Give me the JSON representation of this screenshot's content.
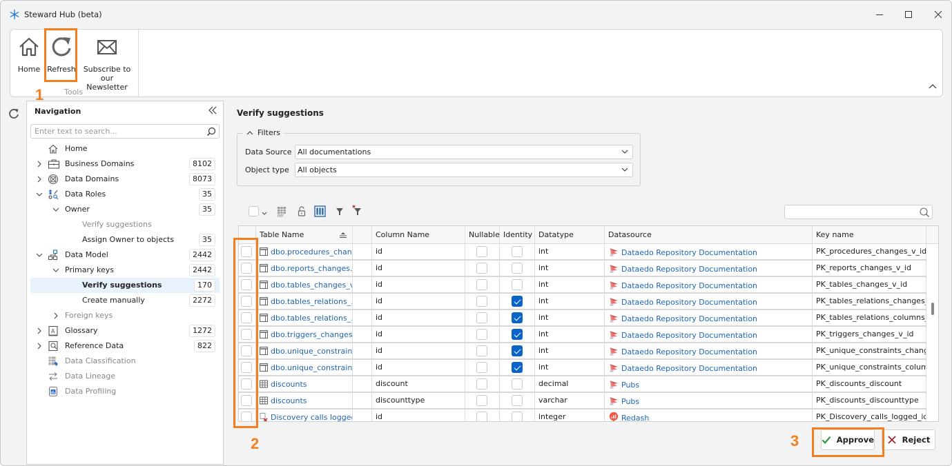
{
  "window": {
    "title": "Steward Hub (beta)",
    "controls": [
      "minimize",
      "maximize",
      "close"
    ]
  },
  "ribbon": {
    "buttons": [
      {
        "label": "Home",
        "icon": "home-icon"
      },
      {
        "label": "Refresh",
        "icon": "refresh-icon"
      },
      {
        "label": "Subscribe to our Newsletter",
        "line1": "Subscribe to",
        "line2": "our Newsletter",
        "icon": "envelope-icon"
      }
    ],
    "group_label": "Tools"
  },
  "annotations": {
    "step1": "1",
    "step2": "2",
    "step3": "3",
    "highlight_color": "#f47d20"
  },
  "navigation": {
    "title": "Navigation",
    "search_placeholder": "Enter text to search...",
    "items": [
      {
        "label": "Home",
        "count": null,
        "expander": "none",
        "icon": "home-icon"
      },
      {
        "label": "Business Domains",
        "count": "8102",
        "expander": "collapsed",
        "icon": "briefcase-icon"
      },
      {
        "label": "Data Domains",
        "count": "8073",
        "expander": "collapsed",
        "icon": "globe-icon"
      },
      {
        "label": "Data Roles",
        "count": "35",
        "expander": "expanded",
        "icon": "data-roles-icon"
      },
      {
        "label": "Owner",
        "count": "35",
        "expander": "expanded"
      },
      {
        "label": "Verify suggestions",
        "count": null,
        "dim": true
      },
      {
        "label": "Assign Owner to objects",
        "count": "35"
      },
      {
        "label": "Data Model",
        "count": "2442",
        "expander": "expanded",
        "icon": "data-model-icon"
      },
      {
        "label": "Primary keys",
        "count": "2442",
        "expander": "expanded"
      },
      {
        "label": "Verify suggestions",
        "count": "170",
        "selected": true
      },
      {
        "label": "Create manually",
        "count": "2272"
      },
      {
        "label": "Foreign keys",
        "count": null,
        "expander": "collapsed",
        "dim": true
      },
      {
        "label": "Glossary",
        "count": "1272",
        "expander": "collapsed",
        "icon": "glossary-icon"
      },
      {
        "label": "Reference Data",
        "count": "822",
        "expander": "collapsed",
        "icon": "reference-data-icon"
      },
      {
        "label": "Data Classification",
        "count": null,
        "dim": true,
        "icon": "classification-icon"
      },
      {
        "label": "Data Lineage",
        "count": null,
        "dim": true,
        "icon": "lineage-icon"
      },
      {
        "label": "Data Profiling",
        "count": null,
        "dim": true,
        "icon": "profiling-icon"
      }
    ]
  },
  "main": {
    "title": "Verify suggestions",
    "filters": {
      "legend": "Filters",
      "data_source_label": "Data Source",
      "data_source_value": "All documentations",
      "object_type_label": "Object type",
      "object_type_value": "All objects"
    },
    "grid": {
      "search_value": "",
      "columns": [
        "Table Name",
        "Column Name",
        "Nullable",
        "Identity",
        "Datatype",
        "Datasource",
        "Key name"
      ],
      "rows": [
        {
          "selected": false,
          "table": "dbo.procedures_chan...",
          "table_icon": "view-icon",
          "column": "id",
          "nullable": false,
          "identity": false,
          "datatype": "int",
          "datasource": "Dataedo Repository Documentation",
          "ds_icon": "sqlserver-icon",
          "key": "PK_procedures_changes_v_id"
        },
        {
          "selected": false,
          "table": "dbo.reports_changes...",
          "table_icon": "view-icon",
          "column": "id",
          "nullable": false,
          "identity": false,
          "datatype": "int",
          "datasource": "Dataedo Repository Documentation",
          "ds_icon": "sqlserver-icon",
          "key": "PK_reports_changes_v_id"
        },
        {
          "selected": false,
          "table": "dbo.tables_changes_v",
          "table_icon": "view-icon",
          "column": "id",
          "nullable": false,
          "identity": false,
          "datatype": "int",
          "datasource": "Dataedo Repository Documentation",
          "ds_icon": "sqlserver-icon",
          "key": "PK_tables_changes_v_id"
        },
        {
          "selected": false,
          "table": "dbo.tables_relations_...",
          "table_icon": "view-icon",
          "column": "id",
          "nullable": false,
          "identity": true,
          "datatype": "int",
          "datasource": "Dataedo Repository Documentation",
          "ds_icon": "sqlserver-icon",
          "key": "PK_tables_relations_changes_..."
        },
        {
          "selected": false,
          "table": "dbo.tables_relations_...",
          "table_icon": "view-icon",
          "column": "id",
          "nullable": false,
          "identity": true,
          "datatype": "int",
          "datasource": "Dataedo Repository Documentation",
          "ds_icon": "sqlserver-icon",
          "key": "PK_tables_relations_columns_..."
        },
        {
          "selected": false,
          "table": "dbo.triggers_changes...",
          "table_icon": "view-icon",
          "column": "id",
          "nullable": false,
          "identity": true,
          "datatype": "int",
          "datasource": "Dataedo Repository Documentation",
          "ds_icon": "sqlserver-icon",
          "key": "PK_triggers_changes_v_id"
        },
        {
          "selected": false,
          "table": "dbo.unique_constrain...",
          "table_icon": "view-icon",
          "column": "id",
          "nullable": false,
          "identity": true,
          "datatype": "int",
          "datasource": "Dataedo Repository Documentation",
          "ds_icon": "sqlserver-icon",
          "key": "PK_unique_constraints_chang..."
        },
        {
          "selected": false,
          "table": "dbo.unique_constrain...",
          "table_icon": "view-icon",
          "column": "id",
          "nullable": false,
          "identity": true,
          "datatype": "int",
          "datasource": "Dataedo Repository Documentation",
          "ds_icon": "sqlserver-icon",
          "key": "PK_unique_constraints_column..."
        },
        {
          "selected": false,
          "table": "discounts",
          "table_icon": "table-icon",
          "column": "discount",
          "nullable": false,
          "identity": false,
          "datatype": "decimal",
          "datasource": "Pubs",
          "ds_icon": "sqlserver-icon",
          "key": "PK_discounts_discount"
        },
        {
          "selected": false,
          "table": "discounts",
          "table_icon": "table-icon",
          "column": "discounttype",
          "nullable": false,
          "identity": false,
          "datatype": "varchar",
          "datasource": "Pubs",
          "ds_icon": "sqlserver-icon",
          "key": "PK_discounts_discounttype"
        },
        {
          "selected": false,
          "table": "Discovery calls logged",
          "table_icon": "deleted-object-icon",
          "column": "id",
          "nullable": false,
          "identity": false,
          "datatype": "integer",
          "datasource": "Redash",
          "ds_icon": "redash-icon",
          "key": "PK_Discovery_calls_logged_id"
        }
      ]
    },
    "actions": {
      "approve_label": "Approve",
      "reject_label": "Reject"
    }
  }
}
